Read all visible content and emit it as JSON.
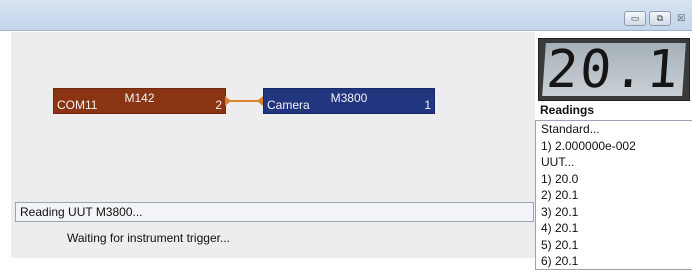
{
  "window": {
    "controls": {
      "minimize_glyph": "▭",
      "restore_glyph": "⧉",
      "close_glyph": "☒"
    }
  },
  "diagram": {
    "source_block": {
      "name": "M142",
      "port_label": "COM11",
      "port_number": "2",
      "color": "#8b3414"
    },
    "target_block": {
      "name": "M3800",
      "port_label": "Camera",
      "port_number": "1",
      "color": "#22357f"
    },
    "connector_color": "#d9822b"
  },
  "status": {
    "message": "Reading UUT M3800...",
    "sub_message": "Waiting for instrument trigger..."
  },
  "display": {
    "value": "20.1"
  },
  "readings": {
    "title": "Readings",
    "items": [
      "Standard...",
      "1) 2.000000e-002",
      "UUT...",
      "1) 20.0",
      "2) 20.1",
      "3) 20.1",
      "4) 20.1",
      "5) 20.1",
      "6) 20.1"
    ]
  }
}
